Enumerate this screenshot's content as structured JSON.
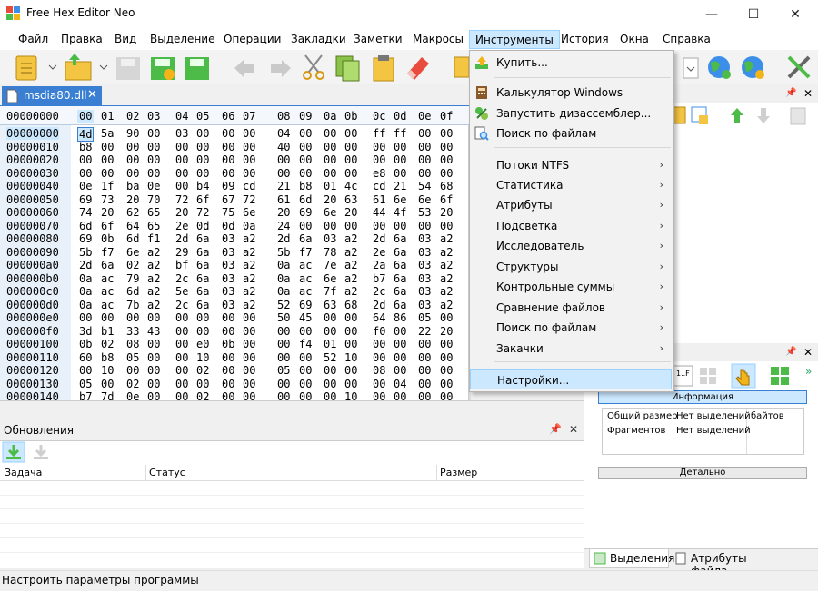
{
  "window": {
    "title": "Free Hex Editor Neo",
    "minimize_glyph": "—",
    "maximize_glyph": "☐",
    "close_glyph": "✕"
  },
  "menubar": [
    "Файл",
    "Правка",
    "Вид",
    "Выделение",
    "Операции",
    "Закладки",
    "Заметки",
    "Макросы",
    "Инструменты",
    "История",
    "Окна",
    "Справка"
  ],
  "tab": {
    "label": "msdia80.dll",
    "close": "✕"
  },
  "hex": {
    "header_offset": "00000000",
    "columns": [
      "00",
      "01",
      "02",
      "03",
      "04",
      "05",
      "06",
      "07",
      "08",
      "09",
      "0a",
      "0b",
      "0c",
      "0d",
      "0e",
      "0f"
    ],
    "rows": [
      {
        "offset": "00000000",
        "bytes": [
          "4d",
          "5a",
          "90",
          "00",
          "03",
          "00",
          "00",
          "00",
          "04",
          "00",
          "00",
          "00",
          "ff",
          "ff",
          "00",
          "00"
        ]
      },
      {
        "offset": "00000010",
        "bytes": [
          "b8",
          "00",
          "00",
          "00",
          "00",
          "00",
          "00",
          "00",
          "40",
          "00",
          "00",
          "00",
          "00",
          "00",
          "00",
          "00"
        ]
      },
      {
        "offset": "00000020",
        "bytes": [
          "00",
          "00",
          "00",
          "00",
          "00",
          "00",
          "00",
          "00",
          "00",
          "00",
          "00",
          "00",
          "00",
          "00",
          "00",
          "00"
        ]
      },
      {
        "offset": "00000030",
        "bytes": [
          "00",
          "00",
          "00",
          "00",
          "00",
          "00",
          "00",
          "00",
          "00",
          "00",
          "00",
          "00",
          "e8",
          "00",
          "00",
          "00"
        ]
      },
      {
        "offset": "00000040",
        "bytes": [
          "0e",
          "1f",
          "ba",
          "0e",
          "00",
          "b4",
          "09",
          "cd",
          "21",
          "b8",
          "01",
          "4c",
          "cd",
          "21",
          "54",
          "68"
        ]
      },
      {
        "offset": "00000050",
        "bytes": [
          "69",
          "73",
          "20",
          "70",
          "72",
          "6f",
          "67",
          "72",
          "61",
          "6d",
          "20",
          "63",
          "61",
          "6e",
          "6e",
          "6f"
        ]
      },
      {
        "offset": "00000060",
        "bytes": [
          "74",
          "20",
          "62",
          "65",
          "20",
          "72",
          "75",
          "6e",
          "20",
          "69",
          "6e",
          "20",
          "44",
          "4f",
          "53",
          "20"
        ]
      },
      {
        "offset": "00000070",
        "bytes": [
          "6d",
          "6f",
          "64",
          "65",
          "2e",
          "0d",
          "0d",
          "0a",
          "24",
          "00",
          "00",
          "00",
          "00",
          "00",
          "00",
          "00"
        ]
      },
      {
        "offset": "00000080",
        "bytes": [
          "69",
          "0b",
          "6d",
          "f1",
          "2d",
          "6a",
          "03",
          "a2",
          "2d",
          "6a",
          "03",
          "a2",
          "2d",
          "6a",
          "03",
          "a2"
        ]
      },
      {
        "offset": "00000090",
        "bytes": [
          "5b",
          "f7",
          "6e",
          "a2",
          "29",
          "6a",
          "03",
          "a2",
          "5b",
          "f7",
          "78",
          "a2",
          "2e",
          "6a",
          "03",
          "a2"
        ]
      },
      {
        "offset": "000000a0",
        "bytes": [
          "2d",
          "6a",
          "02",
          "a2",
          "bf",
          "6a",
          "03",
          "a2",
          "0a",
          "ac",
          "7e",
          "a2",
          "2a",
          "6a",
          "03",
          "a2"
        ]
      },
      {
        "offset": "000000b0",
        "bytes": [
          "0a",
          "ac",
          "79",
          "a2",
          "2c",
          "6a",
          "03",
          "a2",
          "0a",
          "ac",
          "6e",
          "a2",
          "b7",
          "6a",
          "03",
          "a2"
        ]
      },
      {
        "offset": "000000c0",
        "bytes": [
          "0a",
          "ac",
          "6d",
          "a2",
          "5e",
          "6a",
          "03",
          "a2",
          "0a",
          "ac",
          "7f",
          "a2",
          "2c",
          "6a",
          "03",
          "a2"
        ]
      },
      {
        "offset": "000000d0",
        "bytes": [
          "0a",
          "ac",
          "7b",
          "a2",
          "2c",
          "6a",
          "03",
          "a2",
          "52",
          "69",
          "63",
          "68",
          "2d",
          "6a",
          "03",
          "a2"
        ]
      },
      {
        "offset": "000000e0",
        "bytes": [
          "00",
          "00",
          "00",
          "00",
          "00",
          "00",
          "00",
          "00",
          "50",
          "45",
          "00",
          "00",
          "64",
          "86",
          "05",
          "00"
        ]
      },
      {
        "offset": "000000f0",
        "bytes": [
          "3d",
          "b1",
          "33",
          "43",
          "00",
          "00",
          "00",
          "00",
          "00",
          "00",
          "00",
          "00",
          "f0",
          "00",
          "22",
          "20"
        ]
      },
      {
        "offset": "00000100",
        "bytes": [
          "0b",
          "02",
          "08",
          "00",
          "00",
          "e0",
          "0b",
          "00",
          "00",
          "f4",
          "01",
          "00",
          "00",
          "00",
          "00",
          "00"
        ]
      },
      {
        "offset": "00000110",
        "bytes": [
          "60",
          "b8",
          "05",
          "00",
          "00",
          "10",
          "00",
          "00",
          "00",
          "00",
          "52",
          "10",
          "00",
          "00",
          "00",
          "00"
        ]
      },
      {
        "offset": "00000120",
        "bytes": [
          "00",
          "10",
          "00",
          "00",
          "00",
          "02",
          "00",
          "00",
          "05",
          "00",
          "00",
          "00",
          "08",
          "00",
          "00",
          "00"
        ]
      },
      {
        "offset": "00000130",
        "bytes": [
          "05",
          "00",
          "02",
          "00",
          "00",
          "00",
          "00",
          "00",
          "00",
          "00",
          "00",
          "00",
          "00",
          "04",
          "00",
          "00"
        ]
      },
      {
        "offset": "00000140",
        "bytes": [
          "b7",
          "7d",
          "0e",
          "00",
          "00",
          "02",
          "00",
          "00",
          "00",
          "00",
          "00",
          "10",
          "00",
          "00",
          "00",
          "00"
        ]
      }
    ]
  },
  "updates": {
    "title": "Обновления",
    "pin": "📌",
    "close": "✕",
    "columns": [
      "Задача",
      "Статус",
      "Размер"
    ]
  },
  "info": {
    "header": "Информация",
    "rows": [
      [
        "Общий размер",
        "Нет выделений",
        "байтов"
      ],
      [
        "Фрагментов",
        "Нет выделений",
        ""
      ]
    ],
    "details": "Детально"
  },
  "right_tabs": [
    "Выделения",
    "Атрибуты файла"
  ],
  "right_top": {
    "pin": "📌",
    "close": "✕"
  },
  "right_bot": {
    "pin": "📌",
    "close": "✕",
    "more": "»",
    "tool_label": "1..F"
  },
  "statusbar": {
    "text": "Настроить параметры программы"
  },
  "dropdown": {
    "items": [
      {
        "label": "Купить...",
        "icon": "buy-icon",
        "arrow": false
      },
      {
        "label": "Калькулятор Windows",
        "icon": "calculator-icon",
        "arrow": false
      },
      {
        "label": "Запустить дизассемблер...",
        "icon": "disassembler-icon",
        "arrow": false
      },
      {
        "label": "Поиск по файлам",
        "icon": "file-search-icon",
        "arrow": false
      },
      {
        "label": "Потоки NTFS",
        "icon": "",
        "arrow": true
      },
      {
        "label": "Статистика",
        "icon": "",
        "arrow": true
      },
      {
        "label": "Атрибуты",
        "icon": "",
        "arrow": true
      },
      {
        "label": "Подсветка",
        "icon": "",
        "arrow": true
      },
      {
        "label": "Исследователь",
        "icon": "",
        "arrow": true
      },
      {
        "label": "Структуры",
        "icon": "",
        "arrow": true
      },
      {
        "label": "Контрольные суммы",
        "icon": "",
        "arrow": true
      },
      {
        "label": "Сравнение файлов",
        "icon": "",
        "arrow": true
      },
      {
        "label": "Поиск по файлам",
        "icon": "",
        "arrow": true
      },
      {
        "label": "Закачки",
        "icon": "",
        "arrow": true
      },
      {
        "label": "Настройки...",
        "icon": "",
        "arrow": false
      }
    ],
    "arrow_glyph": "›"
  },
  "colors": {
    "accent": "#3a7fd2",
    "highlight": "#cce8ff",
    "offset_bg": "#e8f0fa"
  }
}
